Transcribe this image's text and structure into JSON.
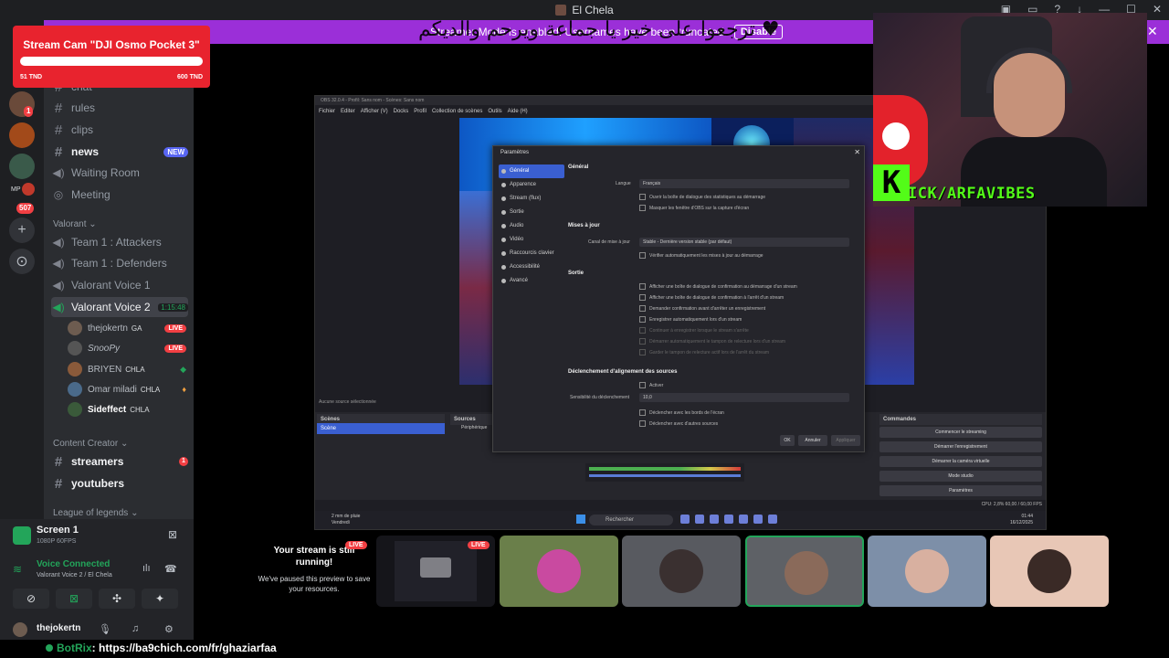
{
  "window": {
    "title": "El Chela"
  },
  "banner": {
    "arabic_text": "ترجعوا على خير يا جماعة ويرحم والديكم ♥",
    "notice": "Streamer Mode is enabled. Usernames have been truncated.",
    "disable_label": "Disable"
  },
  "alert": {
    "title": "Stream Cam \"DJI Osmo Pocket 3\"",
    "progress_fraction": 0.0,
    "current": "51 TND",
    "goal": "600 TND"
  },
  "rail": {
    "badges": [
      "1",
      "507"
    ],
    "ids": [
      "MP"
    ]
  },
  "channels": {
    "top": [
      {
        "name": "chat",
        "type": "text"
      },
      {
        "name": "rules",
        "type": "text"
      },
      {
        "name": "clips",
        "type": "text"
      },
      {
        "name": "news",
        "type": "text",
        "badge": "NEW"
      },
      {
        "name": "Waiting Room",
        "type": "voice"
      },
      {
        "name": "Meeting",
        "type": "stage"
      }
    ],
    "valorant_category": "Valorant",
    "valorant": [
      {
        "name": "Team 1 : Attackers"
      },
      {
        "name": "Team 1 : Defenders"
      },
      {
        "name": "Valorant Voice 1"
      },
      {
        "name": "Valorant Voice 2",
        "time": "1:15:48"
      }
    ],
    "voice_users": [
      {
        "name": "thejokertn",
        "tag": "GA",
        "live": "LIVE"
      },
      {
        "name": "SnooPy",
        "live": "LIVE"
      },
      {
        "name": "BRIYEN",
        "tag": "CHLA"
      },
      {
        "name": "Omar miladi",
        "tag": "CHLA"
      },
      {
        "name": "Sideffect",
        "tag": "CHLA"
      }
    ],
    "content_category": "Content Creator",
    "content": [
      {
        "name": "streamers",
        "badge": "1"
      },
      {
        "name": "youtubers"
      }
    ],
    "league_category": "League of legends"
  },
  "voice_panel": {
    "screen_title": "Screen 1",
    "screen_sub": "1080P 60FPS",
    "connected": "Voice Connected",
    "channel": "Valorant Voice 2 / El Chela"
  },
  "user": {
    "name": "thejokertn"
  },
  "botrix": {
    "name": "BotRix",
    "message": ": https://ba9chich.com/fr/ghaziarfaa"
  },
  "obs": {
    "title": "OBS 32.0.4 - Profil: Sans nom - Scènes: Sans nom",
    "menu": [
      "Fichier",
      "Editer",
      "Afficher (V)",
      "Docks",
      "Profil",
      "Collection de scènes",
      "Outils",
      "Aide (H)"
    ],
    "dock_scenes": "Scènes",
    "dock_sources": "Sources",
    "dock_commands": "Commandes",
    "scene_item": "Scène",
    "source_item": "Périphérique",
    "no_source": "Aucune source sélectionnée",
    "commands": [
      "Commencer le streaming",
      "Démarrer l'enregistrement",
      "Démarrer la caméra virtuelle",
      "Mode studio",
      "Paramètres"
    ],
    "status": "CPU: 2,8%   60,00 / 60,00 FPS",
    "search": "Rechercher",
    "weather_1": "2 mm de pluie",
    "weather_2": "Vendredi",
    "clock_1": "01:44",
    "clock_2": "16/12/2025",
    "dialog": {
      "title": "Paramètres",
      "nav": [
        "Général",
        "Apparence",
        "Stream (flux)",
        "Sortie",
        "Audio",
        "Vidéo",
        "Raccourcis clavier",
        "Accessibilité",
        "Avancé"
      ],
      "sec_general": "Général",
      "langue_label": "Langue",
      "langue_value": "Français",
      "cb_stats": "Ouvrir la boîte de dialogue des statistiques au démarrage",
      "cb_hide": "Masquer les fenêtre d'OBS sur la capture d'écran",
      "sec_updates": "Mises à jour",
      "canal_label": "Canal de mise à jour",
      "canal_value": "Stable - Dernière version stable (par défaut)",
      "cb_auto": "Vérifier automatiquement les mises à jour au démarrage",
      "sec_sortie": "Sortie",
      "sortie": [
        "Afficher une boîte de dialogue de confirmation au démarrage d'un stream",
        "Afficher une boîte de dialogue de confirmation à l'arrêt d'un stream",
        "Demander confirmation avant d'arrêter un enregistrement",
        "Enregistrer automatiquement lors d'un stream",
        "Continuer à enregistrer lorsque le stream s'arrête",
        "Démarrer automatiquement le tampon de relecture lors d'un stream",
        "Garder le tampon de relecture actif lors de l'arrêt du stream"
      ],
      "sec_snap": "Déclenchement d'alignement des sources",
      "snap_enable": "Activer",
      "snap_sens_label": "Sensibilité du déclenchement",
      "snap_sens_value": "10,0",
      "snap_edges": "Déclencher avec les bords de l'écran",
      "snap_other": "Déclencher avec d'autres sources",
      "ok": "OK",
      "cancel": "Annuler",
      "apply": "Appliquer"
    }
  },
  "overlay": {
    "kick_letter": "K",
    "kick_text": "ICK/ARFAVIBES"
  },
  "stream": {
    "paused_line1": "Your stream is still running!",
    "paused_line2": "We've paused this preview to save your resources.",
    "live": "LIVE"
  },
  "colors": {
    "discord_bg": "#313338",
    "sidebar": "#2b2d31",
    "accent_green": "#23a55a",
    "accent_red": "#f23f43",
    "banner_purple": "#9b2fd8",
    "kick_green": "#53fc18"
  }
}
